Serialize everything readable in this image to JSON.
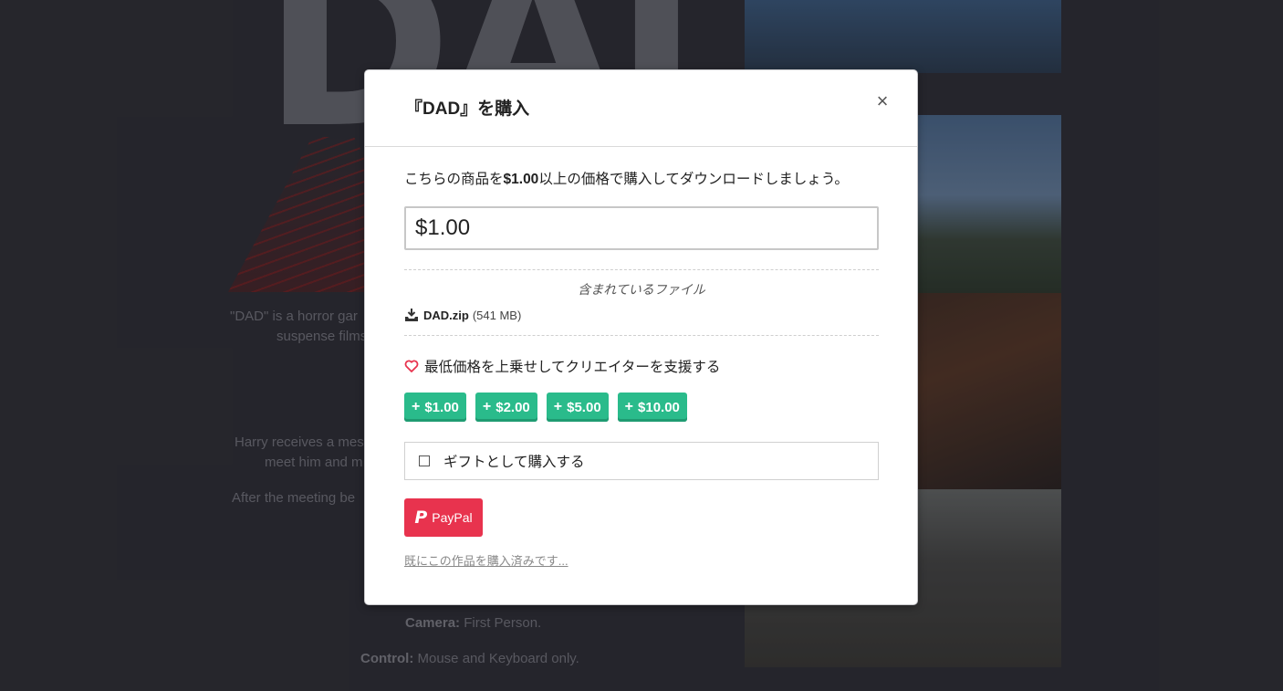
{
  "background": {
    "title": "DAD",
    "desc_line1": "\"DAD\" is a horror gar",
    "desc_line2": "suspense films",
    "story_line1": "Harry receives a mes",
    "story_line2": "meet him and m",
    "story_line3": "After the meeting be",
    "camera_label": "Camera:",
    "camera_value": "First Person.",
    "control_label": "Control:",
    "control_value": "Mouse and Keyboard only."
  },
  "modal": {
    "title": "『DAD』を購入",
    "close_glyph": "×",
    "intro_prefix": "こちらの商品を",
    "intro_price": "$1.00",
    "intro_suffix": "以上の価格で購入してダウンロードしましょう。",
    "price_value": "$1.00",
    "files_heading": "含まれているファイル",
    "file": {
      "name": "DAD.zip",
      "size": "(541 MB)"
    },
    "support_text": "最低価格を上乗せしてクリエイターを支援する",
    "tips": [
      {
        "plus": "+",
        "amount": "$1.00"
      },
      {
        "plus": "+",
        "amount": "$2.00"
      },
      {
        "plus": "+",
        "amount": "$5.00"
      },
      {
        "plus": "+",
        "amount": "$10.00"
      }
    ],
    "gift_label": "ギフトとして購入する",
    "paypal_logo": "P",
    "paypal_label": "PayPal",
    "already_bought": "既にこの作品を購入済みです..."
  },
  "colors": {
    "tip_button": "#2abb8b",
    "paypal_button": "#e8334e",
    "heart": "#e8334e"
  }
}
